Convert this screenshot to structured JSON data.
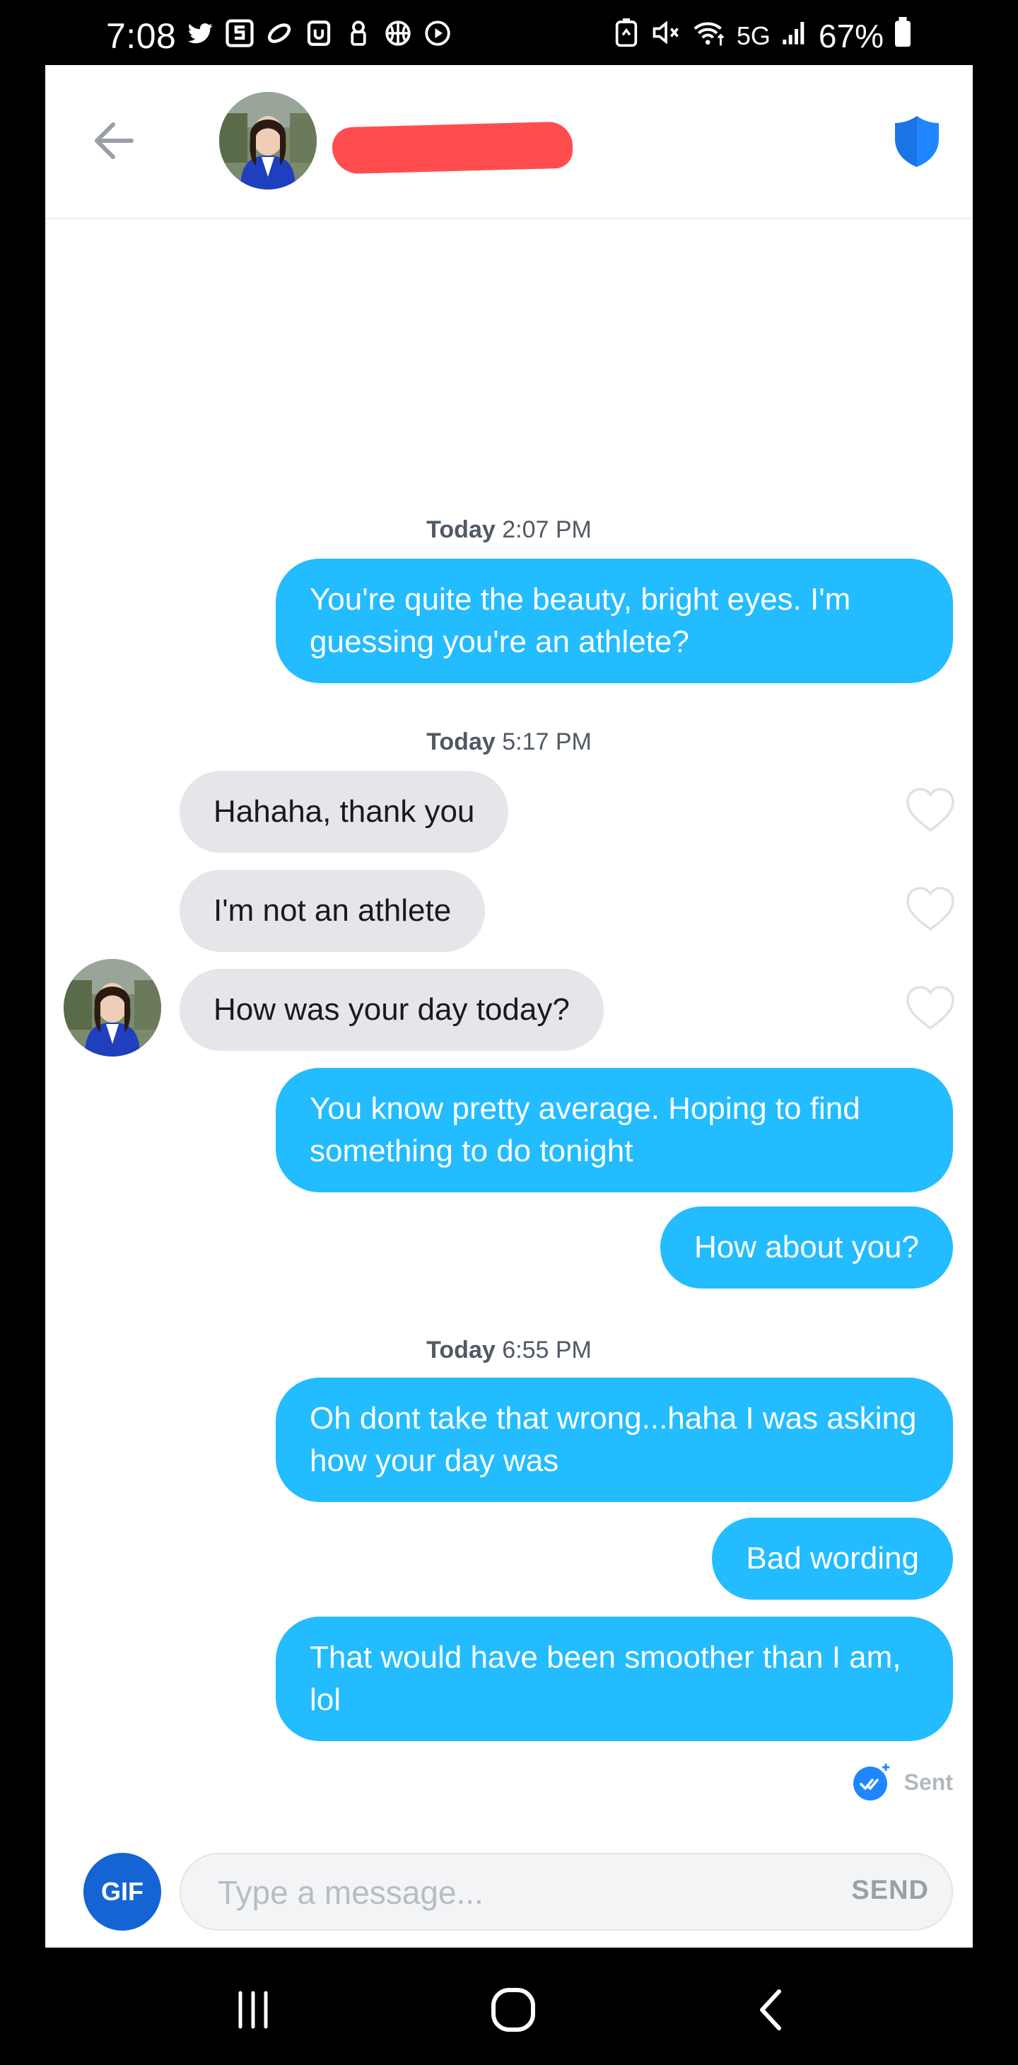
{
  "status_bar": {
    "time": "7:08",
    "network": "5G",
    "battery": "67%",
    "left_icons": [
      "twitter-icon",
      "s-app-icon",
      "link-icon",
      "shield-app-icon",
      "lock-icon",
      "basketball-icon",
      "play-icon"
    ],
    "right_icons": [
      "battery-saver-icon",
      "mute-icon",
      "wifi-icon",
      "signal-icon",
      "battery-icon"
    ]
  },
  "header": {
    "contact_name": "",
    "back_icon": "arrow-left-icon",
    "safety_icon": "shield-icon"
  },
  "colors": {
    "outgoing": "#22bcff",
    "incoming": "#e4e6ea",
    "accent": "#1464d4",
    "redaction": "#ff4d4f"
  },
  "conversation": {
    "groups": [
      {
        "day": "Today",
        "time": "2:07 PM",
        "messages": [
          {
            "direction": "out",
            "text": "You're quite the beauty, bright eyes. I'm guessing you're an athlete?"
          }
        ]
      },
      {
        "day": "Today",
        "time": "5:17 PM",
        "messages": [
          {
            "direction": "in",
            "text": "Hahaha, thank you"
          },
          {
            "direction": "in",
            "text": "I'm not an athlete"
          },
          {
            "direction": "in",
            "text": "How was your day today?"
          },
          {
            "direction": "out",
            "text": "You know pretty average. Hoping to find something to do tonight"
          },
          {
            "direction": "out",
            "text": "How about you?"
          }
        ]
      },
      {
        "day": "Today",
        "time": "6:55 PM",
        "messages": [
          {
            "direction": "out",
            "text": "Oh dont take that wrong...haha I was asking how your day was"
          },
          {
            "direction": "out",
            "text": "Bad wording"
          },
          {
            "direction": "out",
            "text": "That would have been smoother than I am, lol"
          }
        ]
      }
    ],
    "delivery_status": "Sent"
  },
  "composer": {
    "gif_label": "GIF",
    "placeholder": "Type a message...",
    "send_label": "SEND"
  },
  "navbar": {
    "buttons": [
      "recent-apps-icon",
      "home-icon",
      "back-icon"
    ]
  }
}
